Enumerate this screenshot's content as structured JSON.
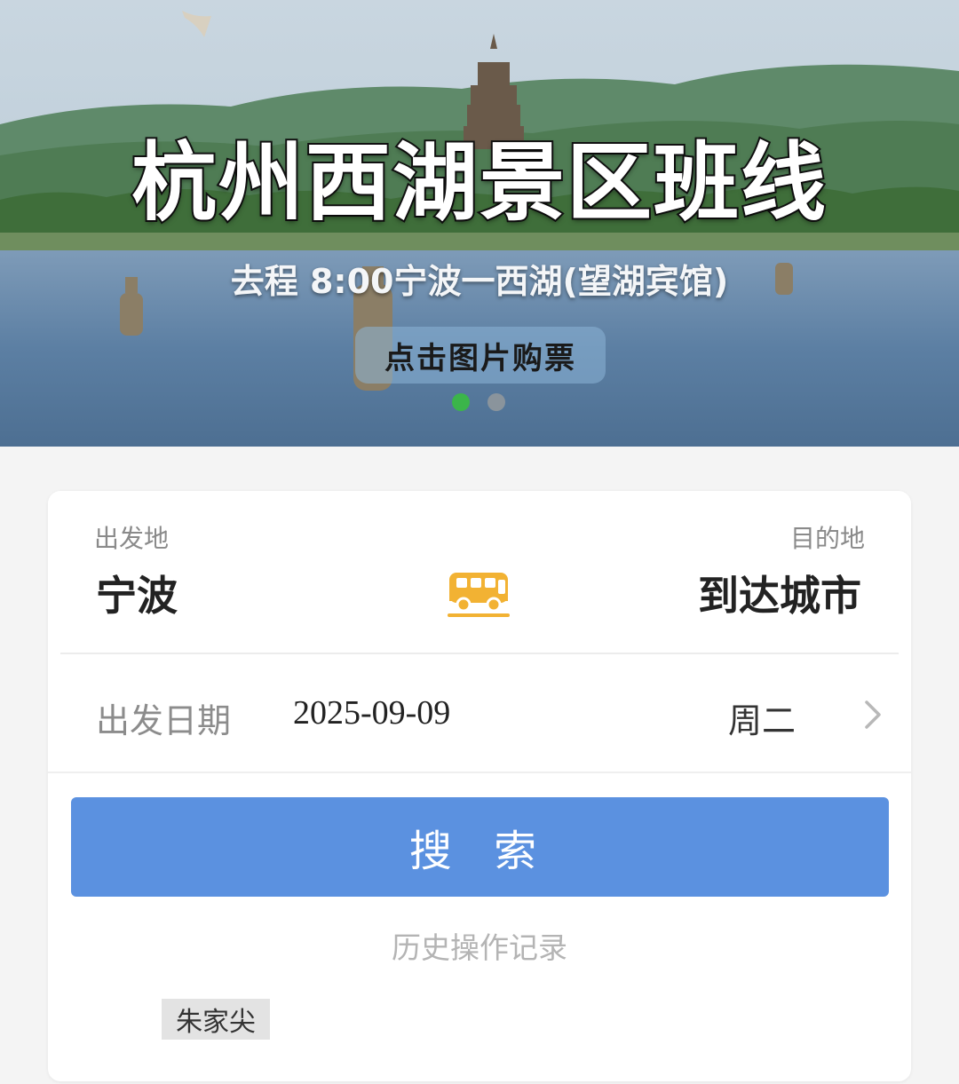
{
  "banner": {
    "title": "杭州西湖景区班线",
    "subtitle": "去程 8:00宁波一西湖(望湖宾馆)",
    "cta": "点击图片购票",
    "slide_count": 2,
    "active_slide": 1,
    "colors": {
      "active_dot": "#3bb54a",
      "inactive_dot": "#8a949c"
    }
  },
  "route": {
    "origin_label": "出发地",
    "origin_value": "宁波",
    "destination_label": "目的地",
    "destination_value": "到达城市",
    "swap_icon": "bus-icon",
    "icon_color": "#f2b233"
  },
  "date_row": {
    "label": "出发日期",
    "value": "2025-09-09",
    "weekday": "周二",
    "chevron_icon": "chevron-right-icon"
  },
  "search": {
    "button_label": "搜 索",
    "color": "#5b91e0"
  },
  "history": {
    "title": "历史操作记录",
    "items": [
      "朱家尖"
    ]
  }
}
